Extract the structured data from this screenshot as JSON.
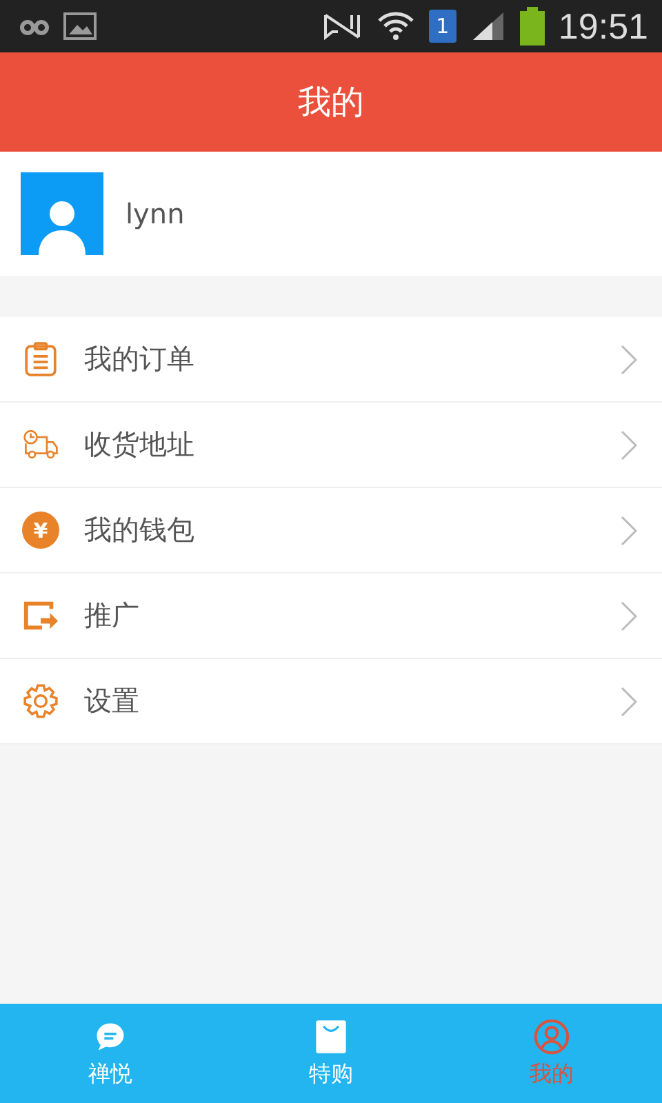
{
  "status_bar": {
    "time": "19:51",
    "sim_slot": "1"
  },
  "header": {
    "title": "我的"
  },
  "profile": {
    "username": "lynn"
  },
  "menu": [
    {
      "label": "我的订单",
      "kind": "order"
    },
    {
      "label": "收货地址",
      "kind": "delivery"
    },
    {
      "label": "我的钱包",
      "kind": "wallet",
      "icon_text": "¥"
    },
    {
      "label": "推广",
      "kind": "share"
    },
    {
      "label": "设置",
      "kind": "settings"
    }
  ],
  "bottom_nav": [
    {
      "label": "禅悦",
      "kind": "chat",
      "selected": false
    },
    {
      "label": "特购",
      "kind": "bag",
      "selected": false
    },
    {
      "label": "我的",
      "kind": "user",
      "selected": true
    }
  ]
}
